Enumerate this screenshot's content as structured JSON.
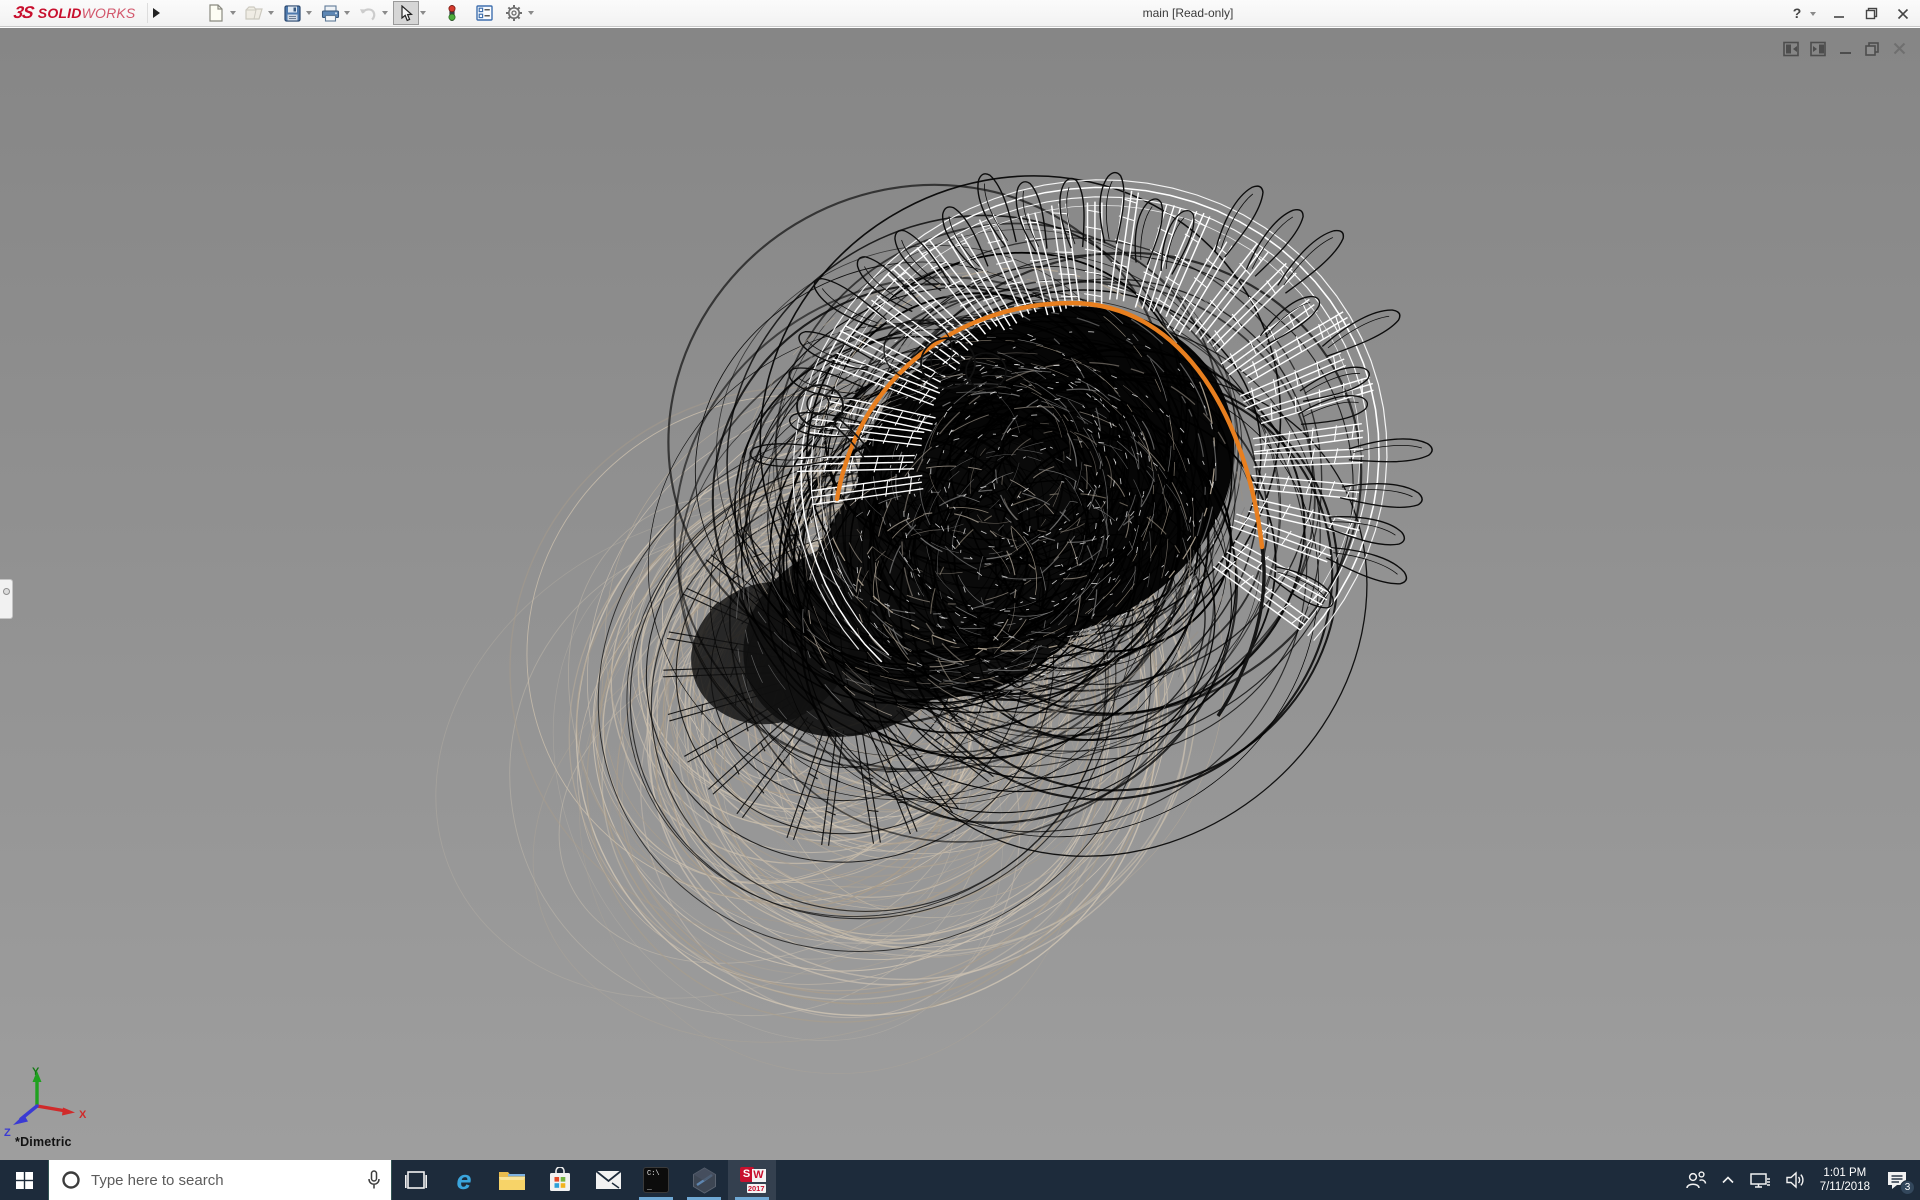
{
  "titlebar": {
    "logo_mark": "3S",
    "brand_bold": "SOLID",
    "brand_light": "WORKS",
    "title": "main [Read-only]",
    "help_label": "?",
    "toolbar_icons": [
      "new-document",
      "open",
      "save",
      "print",
      "undo",
      "select",
      "rebuild-stoplight",
      "options-list",
      "settings-gear"
    ]
  },
  "window_controls": [
    "help",
    "minimize",
    "restore",
    "close"
  ],
  "document_controls": [
    "pane-left",
    "pane-right",
    "minimize",
    "restore",
    "close-disabled"
  ],
  "viewport": {
    "view_label": "*Dimetric",
    "triad": {
      "x": "X",
      "y": "Y",
      "z": "Z"
    }
  },
  "taskbar": {
    "search_placeholder": "Type here to search",
    "apps": [
      "start",
      "search",
      "task-view",
      "edge",
      "file-explorer",
      "store",
      "mail",
      "command-prompt",
      "hex-app",
      "solidworks-2017"
    ],
    "open_apps": [
      "command-prompt",
      "hex-app",
      "solidworks-2017"
    ],
    "edge_letter": "e",
    "cmd_line1": "C:\\",
    "cmd_line2": "_",
    "sw_letter_s": "S",
    "sw_letter_w": "W",
    "sw_year": "2017",
    "tray": {
      "clock_time": "1:01 PM",
      "clock_date": "7/11/2018",
      "notification_count": "3"
    }
  },
  "colors": {
    "accent_orange": "#e87f1f",
    "solidworks_red": "#c8102e",
    "taskbar_bg": "#1d2b3b",
    "open_indicator_blue": "#6fa8d4",
    "viewport_gray_top": "#868686",
    "viewport_gray_bottom": "#9e9e9e",
    "wire_tan": "#b7aa99",
    "wire_tan2": "#c6bbaa",
    "wire_tan3": "#a99d8c",
    "wire_black": "#0a0a0a",
    "wire_white": "#ffffff",
    "triad_x_red": "#d02a2a",
    "triad_y_green": "#1fa11f",
    "triad_z_blue": "#3a3ad4"
  }
}
